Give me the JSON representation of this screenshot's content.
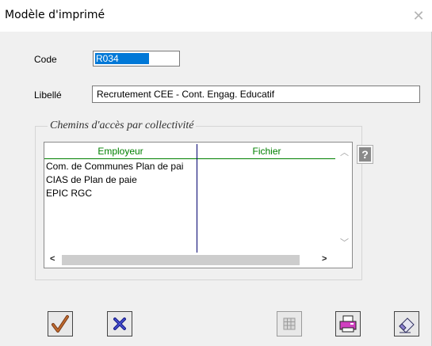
{
  "window": {
    "title": "Modèle d'imprimé"
  },
  "form": {
    "code_label": "Code",
    "code_value": "R034",
    "libelle_label": "Libellé",
    "libelle_value": "Recrutement CEE - Cont. Engag. Educatif"
  },
  "group": {
    "title": "Chemins d'accès par collectivité",
    "columns": [
      "Employeur",
      "Fichier"
    ],
    "rows": [
      {
        "employeur": "Com. de Communes Plan de pai",
        "fichier": ""
      },
      {
        "employeur": "CIAS de Plan de paie",
        "fichier": ""
      },
      {
        "employeur": "EPIC RGC",
        "fichier": ""
      }
    ]
  },
  "icons": {
    "help": "question-mark-icon",
    "validate": "checkmark-icon",
    "cancel": "cross-icon",
    "grid": "grid-icon",
    "print": "printer-icon",
    "edit": "eraser-icon"
  },
  "colors": {
    "selection": "#0078d7",
    "column_header": "#008000",
    "separator": "#00006e"
  }
}
